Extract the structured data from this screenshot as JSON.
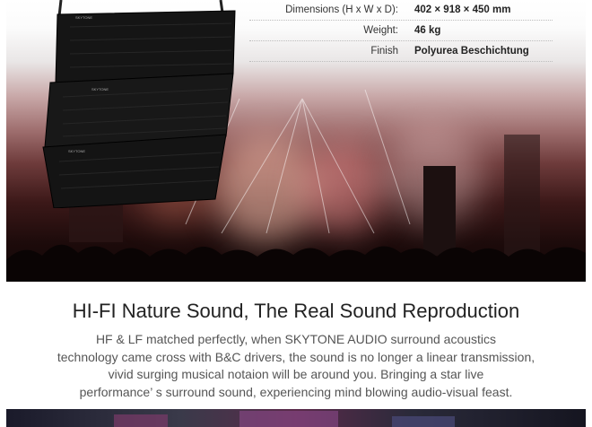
{
  "specs": [
    {
      "label": "Dimensions (H x W x D):",
      "value": "402 × 918 × 450 mm"
    },
    {
      "label": "Weight:",
      "value": "46 kg"
    },
    {
      "label": "Finish",
      "value": "Polyurea Beschichtung"
    }
  ],
  "speaker_brand": "SKYTONE",
  "headline": "HI-FI Nature Sound, The Real Sound Reproduction",
  "description_lines": [
    "HF & LF matched perfectly, when SKYTONE AUDIO surround acoustics",
    "technology came cross with B&C drivers, the sound is no longer a linear transmission,",
    "vivid surging musical notaion will be around you. Bringing a star live",
    "performance’ s surround sound, experiencing mind blowing audio-visual feast."
  ]
}
